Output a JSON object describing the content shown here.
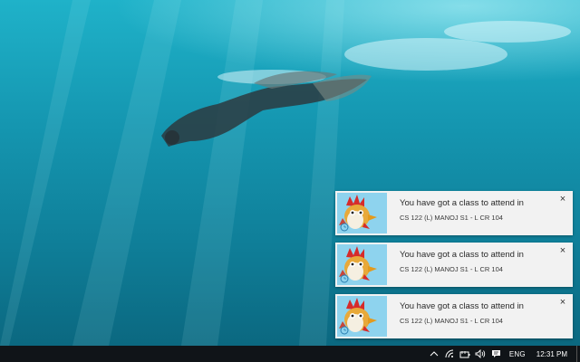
{
  "desktop": {
    "wallpaper": "underwater-freediver"
  },
  "notifications": [
    {
      "title": "You have got a class to attend in",
      "detail": "CS 122 (L) MANOJ S1 - L CR 104",
      "icon": "rooster-mascot-icon",
      "close": "×"
    },
    {
      "title": "You have got a class to attend in",
      "detail": "CS 122 (L) MANOJ S1 - L CR 104",
      "icon": "rooster-mascot-icon",
      "close": "×"
    },
    {
      "title": "You have got a class to attend in",
      "detail": "CS 122 (L) MANOJ S1 - L CR 104",
      "icon": "rooster-mascot-icon",
      "close": "×"
    }
  ],
  "taskbar": {
    "tray_icons": [
      "chevron-up-icon",
      "wifi-icon",
      "battery-icon",
      "volume-icon",
      "action-center-icon"
    ],
    "language": "ENG",
    "time": "12:31 PM"
  },
  "colors": {
    "taskbar": "#101418",
    "toast_bg": "#f2f2f2",
    "water": "#1692ad"
  }
}
